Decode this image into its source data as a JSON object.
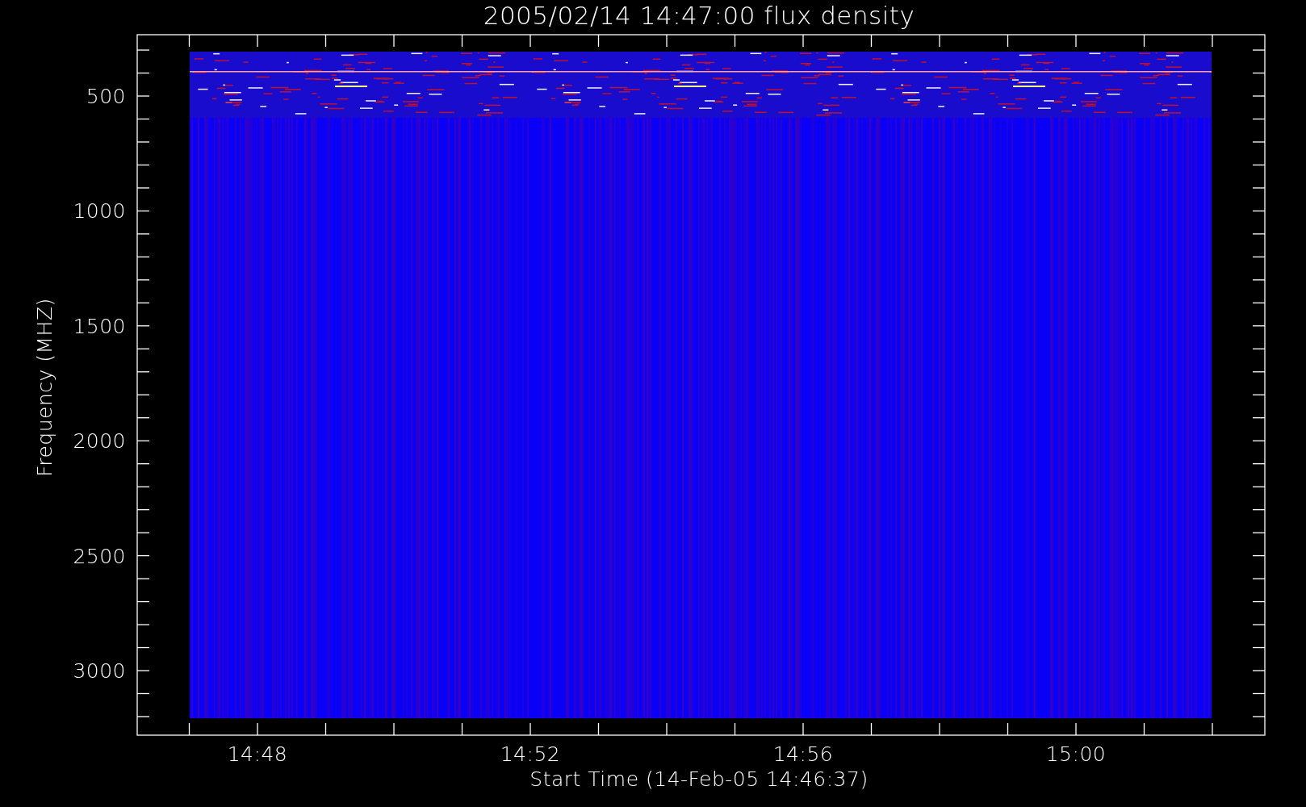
{
  "chart": {
    "title": "2005/02/14 14:47:00 flux density",
    "xlabel": "Start Time (14-Feb-05 14:46:37)",
    "ylabel": "Frequency (MHZ)",
    "xticks": [
      "14:48",
      "14:52",
      "14:56",
      "15:00"
    ],
    "yticks": [
      "500",
      "1000",
      "1500",
      "2000",
      "2500",
      "3000"
    ]
  }
}
